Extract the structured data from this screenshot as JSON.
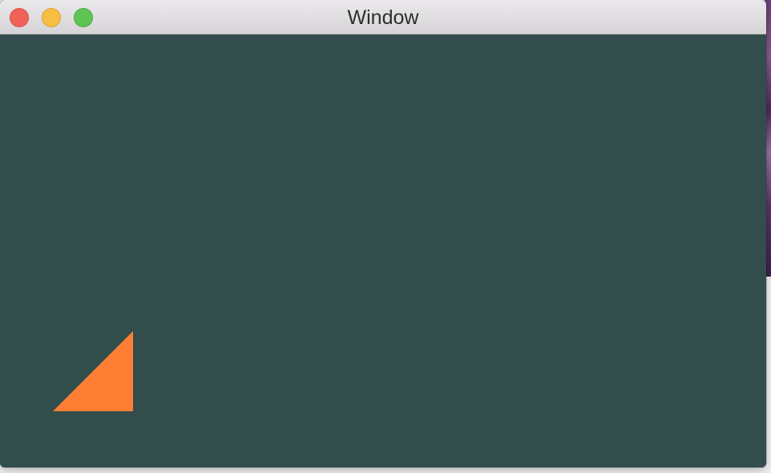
{
  "window": {
    "title": "Window",
    "content_background": "#334d4d"
  },
  "shapes": [
    {
      "name": "orange-triangle",
      "color": "#fe7f33"
    }
  ],
  "colors": {
    "close": "#f0625a",
    "minimize": "#f8be43",
    "zoom": "#5fc453"
  }
}
